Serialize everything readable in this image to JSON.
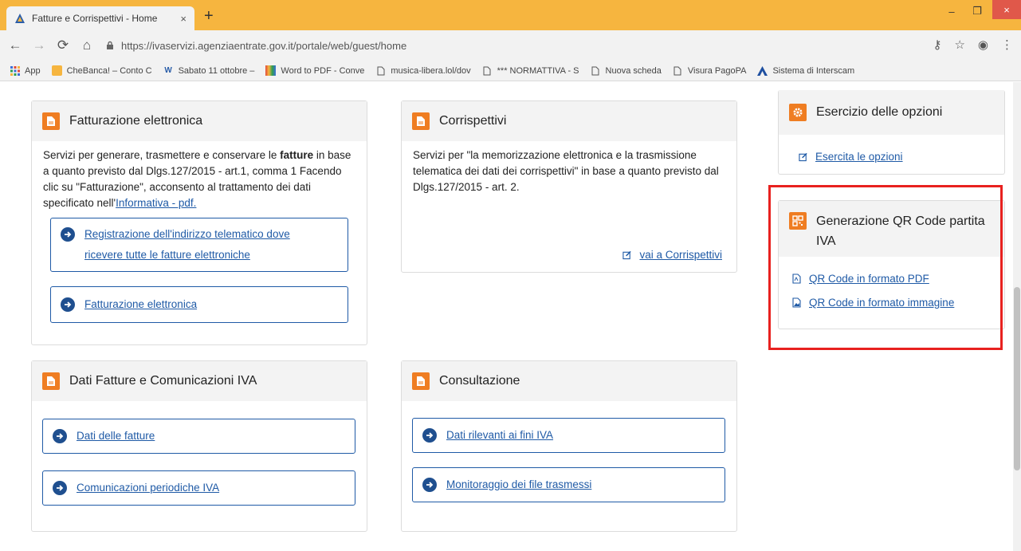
{
  "browser": {
    "tab_title": "Fatture e Corrispettivi - Home",
    "tab_close": "×",
    "new_tab": "+",
    "url": "https://ivaservizi.agenziaentrate.gov.it/portale/web/guest/home",
    "window_controls": {
      "minimize": "–",
      "maximize": "❐",
      "close": "×"
    },
    "bookmarks": [
      {
        "label": "App",
        "icon": "apps-grid-icon"
      },
      {
        "label": "CheBanca! – Conto C",
        "icon": "bookmark-favicon-yellow"
      },
      {
        "label": "Sabato 11 ottobre – ",
        "icon": "w-favicon"
      },
      {
        "label": "Word to PDF - Conve",
        "icon": "colorful-favicon"
      },
      {
        "label": "musica-libera.lol/dov",
        "icon": "page-icon"
      },
      {
        "label": "*** NORMATTIVA - S",
        "icon": "page-icon"
      },
      {
        "label": "Nuova scheda",
        "icon": "page-icon"
      },
      {
        "label": "Visura PagoPA",
        "icon": "page-icon"
      },
      {
        "label": "Sistema di Interscam",
        "icon": "a-logo-icon"
      }
    ]
  },
  "cards": {
    "fatturazione": {
      "title": "Fatturazione elettronica",
      "text_1": "Servizi per generare, trasmettere e conservare le ",
      "text_bold": "fatture",
      "text_2": " in base a quanto previsto dal Dlgs.127/2015 - art.1, comma 1 Facendo clic su \"Fatturazione\", acconsento al trattamento dei dati specificato nell'",
      "text_link": "Informativa - pdf.",
      "buttons": [
        "Registrazione dell'indirizzo telematico dove ricevere tutte le fatture elettroniche",
        "Fatturazione elettronica"
      ]
    },
    "corrispettivi": {
      "title": "Corrispettivi",
      "text": "Servizi per \"la memorizzazione elettronica e la trasmissione telematica dei dati dei corrispettivi\" in base a quanto previsto dal Dlgs.127/2015 - art. 2.",
      "link": "vai a Corrispettivi"
    },
    "dati_fatture": {
      "title": "Dati Fatture e Comunicazioni IVA",
      "buttons": [
        "Dati delle fatture",
        "Comunicazioni periodiche IVA"
      ]
    },
    "consultazione": {
      "title": "Consultazione",
      "buttons": [
        "Dati rilevanti ai fini IVA",
        "Monitoraggio dei file trasmessi"
      ]
    },
    "opzioni": {
      "title": "Esercizio delle opzioni",
      "link": "Esercita le opzioni"
    },
    "qrcode": {
      "title": "Generazione QR Code partita IVA",
      "links": [
        "QR Code in formato PDF",
        "QR Code in formato immagine"
      ]
    }
  },
  "colors": {
    "accent_orange": "#ef7d22",
    "link_blue": "#1f5aa6",
    "highlight_red": "#e8211f",
    "tab_strip": "#f6b53f"
  }
}
